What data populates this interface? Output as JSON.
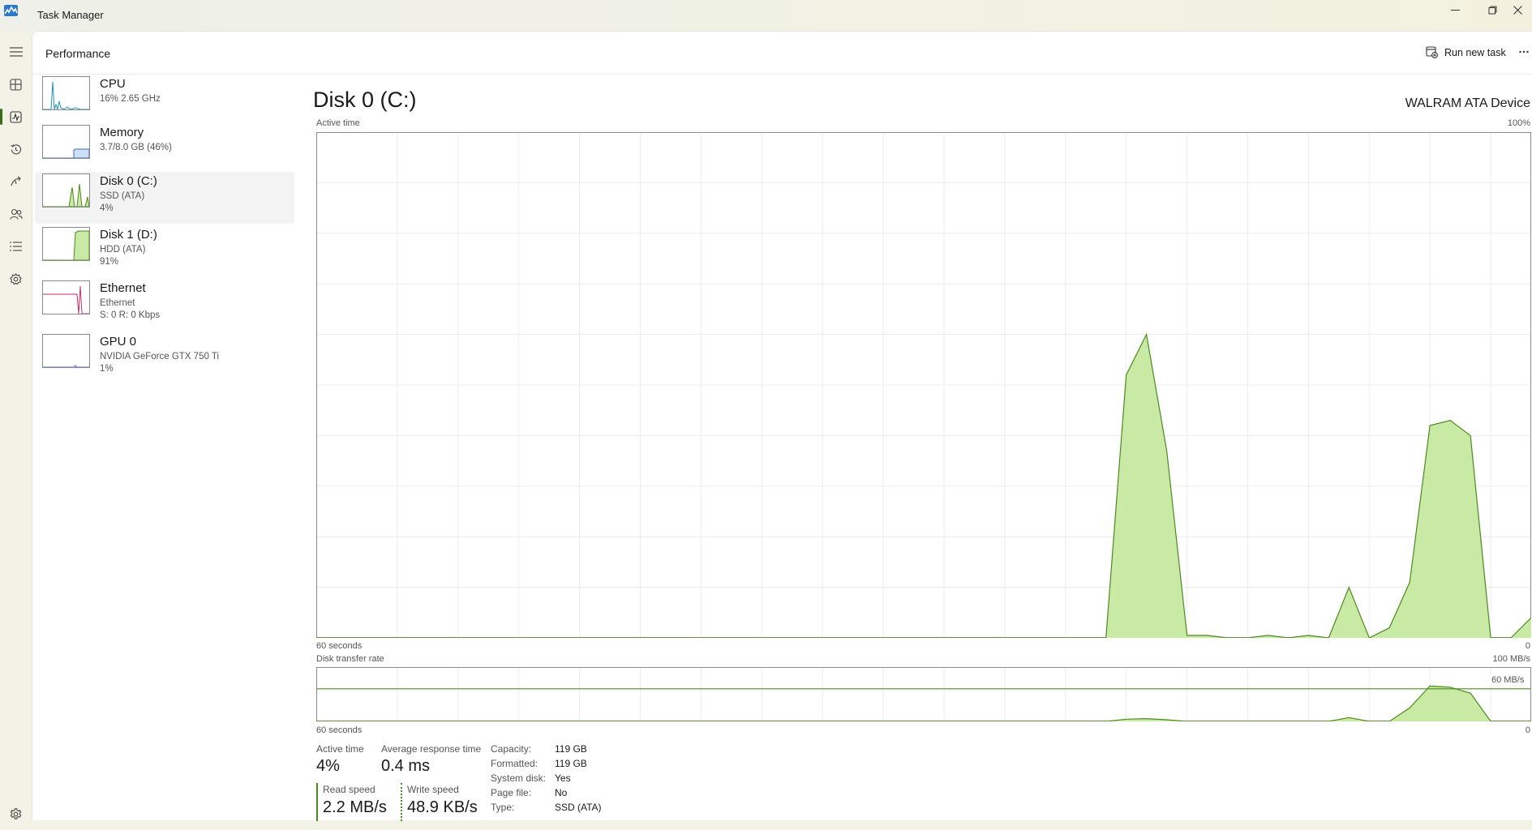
{
  "window": {
    "title": "Task Manager",
    "controls": {
      "minimize": "minimize-icon",
      "restore": "restore-icon",
      "close": "close-icon"
    }
  },
  "nav": {
    "items": [
      {
        "name": "hamburger-icon",
        "active": false
      },
      {
        "name": "processes-icon",
        "active": false
      },
      {
        "name": "performance-icon",
        "active": true
      },
      {
        "name": "app-history-icon",
        "active": false
      },
      {
        "name": "startup-apps-icon",
        "active": false
      },
      {
        "name": "users-icon",
        "active": false
      },
      {
        "name": "details-icon",
        "active": false
      },
      {
        "name": "services-icon",
        "active": false
      }
    ],
    "settings": "settings-icon"
  },
  "header": {
    "title": "Performance",
    "run_task": "Run new task",
    "more": "more-icon"
  },
  "devices": [
    {
      "name": "CPU",
      "line1": "16%  2.65 GHz",
      "line2": "",
      "color": "#1f8fb5",
      "fill": "#ffffff"
    },
    {
      "name": "Memory",
      "line1": "3.7/8.0 GB (46%)",
      "line2": "",
      "color": "#4169c9",
      "fill": "#cde0f8"
    },
    {
      "name": "Disk 0 (C:)",
      "line1": "SSD (ATA)",
      "line2": "4%",
      "color": "#4d8a1d",
      "fill": "#c8eaa4",
      "selected": true
    },
    {
      "name": "Disk 1 (D:)",
      "line1": "HDD (ATA)",
      "line2": "91%",
      "color": "#4d8a1d",
      "fill": "#c8eaa4"
    },
    {
      "name": "Ethernet",
      "line1": "Ethernet",
      "line2": "S: 0  R: 0 Kbps",
      "color": "#b8316c",
      "fill": "#ffffff"
    },
    {
      "name": "GPU 0",
      "line1": "NVIDIA GeForce GTX 750 Ti",
      "line2": "1%",
      "color": "#4169c9",
      "fill": "#ffffff"
    }
  ],
  "detail": {
    "title": "Disk 0 (C:)",
    "model": "WALRAM ATA Device",
    "active_time_label": "Active time",
    "active_time_max": "100%",
    "x_label_left": "60 seconds",
    "x_label_right": "0",
    "transfer_label": "Disk transfer rate",
    "transfer_max": "100 MB/s",
    "transfer_line_label": "60 MB/s",
    "x2_label_left": "60 seconds",
    "x2_label_right": "0",
    "line_color": "#4d8a1d",
    "fill_color": "#c8eaa4"
  },
  "chart_data": [
    {
      "type": "area",
      "title": "Active time",
      "ylim": [
        0,
        100
      ],
      "y_unit": "%",
      "x_range_seconds": [
        60,
        0
      ],
      "grid": true,
      "x_seconds_ago": [
        60,
        21,
        20,
        19,
        18,
        17,
        16,
        15,
        14,
        13,
        12,
        11,
        10,
        9,
        8,
        7,
        6,
        5,
        4,
        3,
        2,
        1,
        0
      ],
      "values": [
        0,
        0,
        52,
        60,
        37,
        0.5,
        0.5,
        0,
        0,
        0.5,
        0,
        0.5,
        0,
        10,
        0,
        2,
        11,
        42,
        43,
        40,
        0,
        0,
        4
      ]
    },
    {
      "type": "area",
      "title": "Disk transfer rate",
      "ylim": [
        0,
        100
      ],
      "y_unit": "MB/s",
      "x_range_seconds": [
        60,
        0
      ],
      "reference_line": 60,
      "x_seconds_ago": [
        60,
        21,
        20,
        19,
        18,
        17,
        16,
        15,
        14,
        13,
        12,
        11,
        10,
        9,
        8,
        7,
        6,
        5,
        4,
        3,
        2,
        1,
        0
      ],
      "values": [
        0,
        0,
        4,
        5,
        3,
        0,
        0,
        0,
        0,
        0,
        0,
        0,
        0,
        7,
        0,
        0,
        25,
        65,
        63,
        52,
        0,
        0,
        0
      ]
    }
  ],
  "stats": {
    "active_time": {
      "label": "Active time",
      "value": "4%"
    },
    "avg_response": {
      "label": "Average response time",
      "value": "0.4 ms"
    },
    "read_speed": {
      "label": "Read speed",
      "value": "2.2 MB/s"
    },
    "write_speed": {
      "label": "Write speed",
      "value": "48.9 KB/s"
    },
    "props": [
      {
        "key": "Capacity:",
        "value": "119 GB"
      },
      {
        "key": "Formatted:",
        "value": "119 GB"
      },
      {
        "key": "System disk:",
        "value": "Yes"
      },
      {
        "key": "Page file:",
        "value": "No"
      },
      {
        "key": "Type:",
        "value": "SSD (ATA)"
      }
    ]
  }
}
